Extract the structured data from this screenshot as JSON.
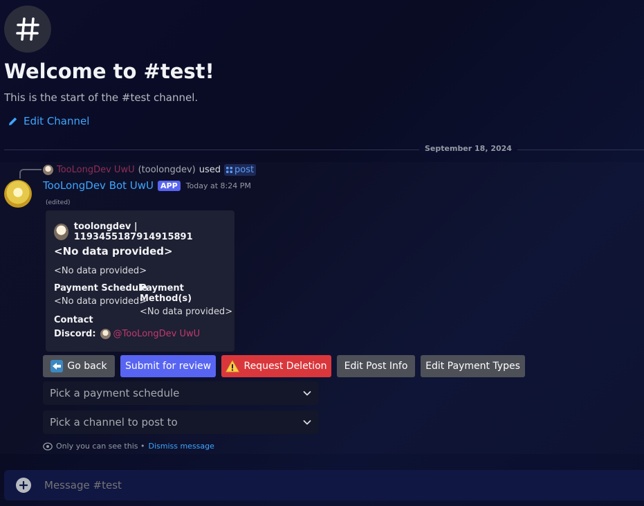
{
  "header": {
    "title": "Welcome to #test!",
    "subtitle": "This is the start of the #test channel.",
    "edit_channel": "Edit Channel"
  },
  "divider": {
    "date": "September 18, 2024"
  },
  "reply": {
    "name": "TooLongDev UwU",
    "username": "(toolongdev)",
    "used": "used",
    "command": "post"
  },
  "message": {
    "author": "TooLongDev Bot UwU",
    "badge": "APP",
    "timestamp": "Today at 8:24 PM",
    "edited": "(edited)"
  },
  "embed": {
    "author": "toolongdev | 1193455187914915891",
    "title": "<No data provided>",
    "description": "<No data provided>",
    "fields": [
      {
        "name": "Payment Schedule",
        "value": "<No data provided>"
      },
      {
        "name": "Payment Method(s)",
        "value": "<No data provided>"
      }
    ],
    "contact_label": "Contact",
    "discord_label": "Discord:",
    "mention": "@TooLongDev UwU"
  },
  "buttons": {
    "go_back": "Go back",
    "submit": "Submit for review",
    "request_deletion": "Request Deletion",
    "edit_post_info": "Edit Post Info",
    "edit_payment_types": "Edit Payment Types"
  },
  "selects": {
    "payment_schedule": "Pick a payment schedule",
    "channel": "Pick a channel to post to"
  },
  "ephemeral": {
    "notice": "Only you can see this •",
    "dismiss": "Dismiss message"
  },
  "composer": {
    "placeholder": "Message #test"
  },
  "colors": {
    "link": "#3ea6ff",
    "blurple": "#5865f2",
    "danger": "#da373c",
    "secondary": "#4e5058",
    "mention": "#c03a6f"
  },
  "icons": [
    "hash-icon",
    "pencil-icon",
    "slash-command-icon",
    "back-arrow-icon",
    "warning-icon",
    "chevron-down-icon",
    "eye-icon",
    "plus-icon"
  ]
}
